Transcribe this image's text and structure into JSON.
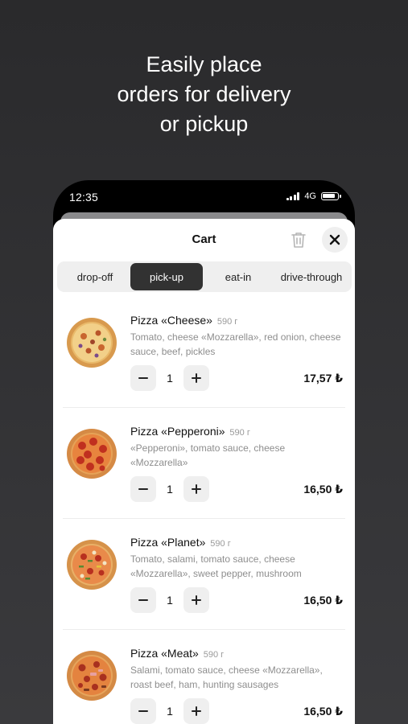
{
  "promo": {
    "headline_lines": [
      "Easily place",
      "orders for delivery",
      "or pickup"
    ]
  },
  "status_bar": {
    "time": "12:35",
    "network": "4G"
  },
  "cart": {
    "title": "Cart",
    "tabs": [
      {
        "label": "drop-off",
        "active": false
      },
      {
        "label": "pick-up",
        "active": true
      },
      {
        "label": "eat-in",
        "active": false
      },
      {
        "label": "drive-through",
        "active": false
      }
    ],
    "items": [
      {
        "name": "Pizza «Cheese»",
        "weight": "590 г",
        "description": "Tomato, cheese «Mozzarella», red onion, cheese sauce, beef, pickles",
        "quantity": "1",
        "price": "17,57 ₺",
        "topping": "cheese"
      },
      {
        "name": "Pizza «Pepperoni»",
        "weight": "590 г",
        "description": "«Pepperoni», tomato sauce, cheese «Mozzarella»",
        "quantity": "1",
        "price": "16,50 ₺",
        "topping": "pepperoni"
      },
      {
        "name": "Pizza «Planet»",
        "weight": "590 г",
        "description": "Tomato, salami, tomato sauce, cheese «Mozzarella», sweet pepper, mushroom",
        "quantity": "1",
        "price": "16,50 ₺",
        "topping": "planet"
      },
      {
        "name": "Pizza «Meat»",
        "weight": "590 г",
        "description": "Salami, tomato sauce, cheese «Mozzarella», roast beef, ham, hunting sausages",
        "quantity": "1",
        "price": "16,50 ₺",
        "topping": "meat"
      }
    ]
  },
  "colors": {
    "background": "#2e2e30",
    "active_tab": "#323232",
    "muted_text": "#8e8e8e",
    "control_bg": "#efefef"
  }
}
